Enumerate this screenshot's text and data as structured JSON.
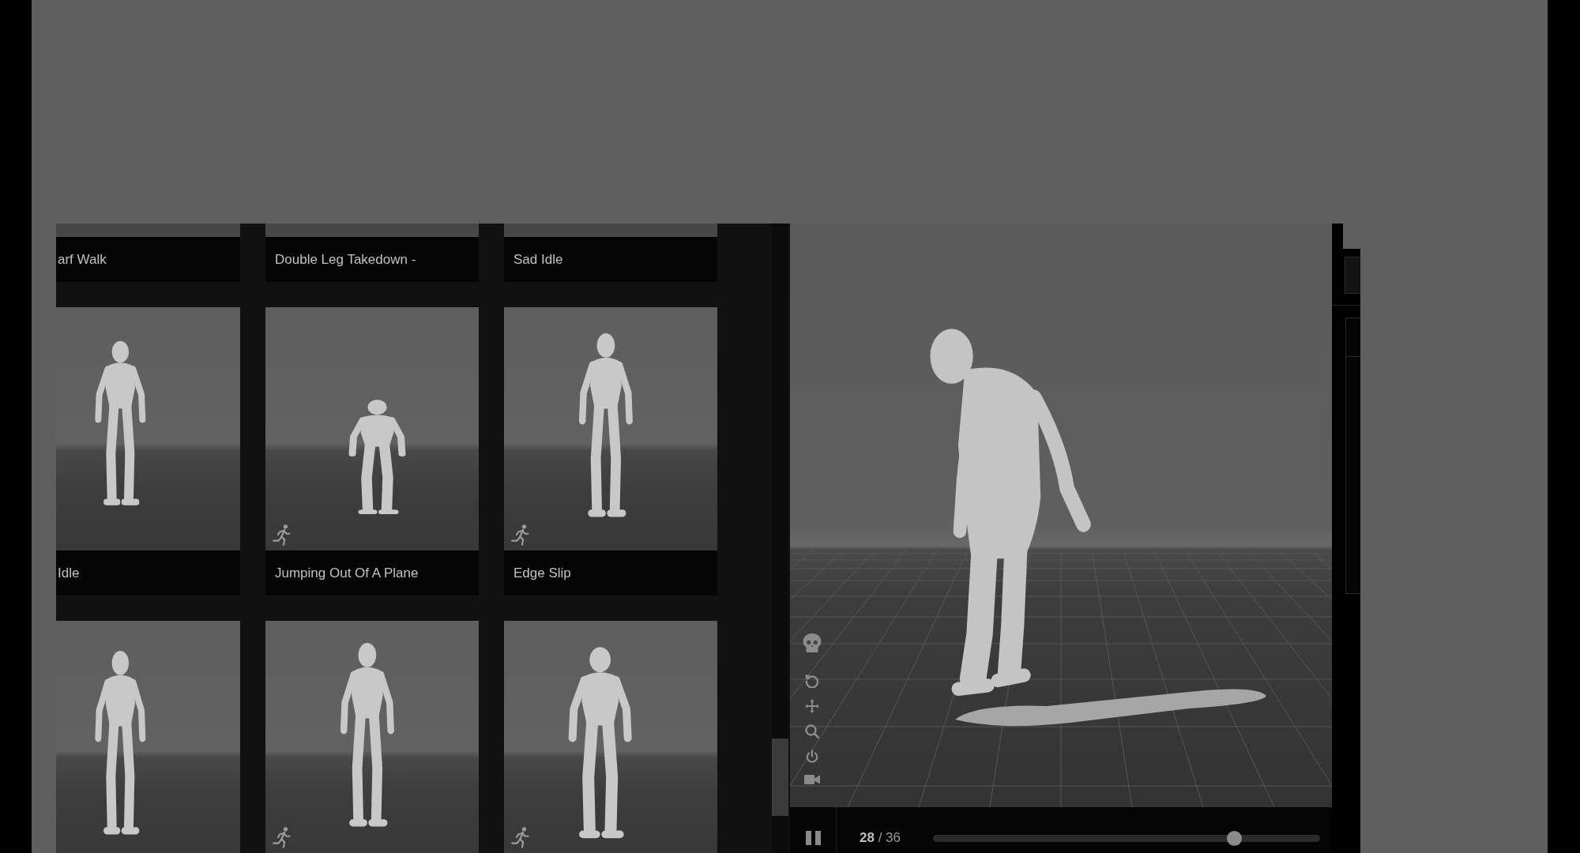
{
  "library": {
    "cards": [
      {
        "title": "arf Walk",
        "motion_badge": false
      },
      {
        "title": "Double Leg Takedown -",
        "motion_badge": false
      },
      {
        "title": "Sad Idle",
        "motion_badge": false
      },
      {
        "title": "Idle",
        "motion_badge": false
      },
      {
        "title": "Jumping Out Of A Plane",
        "motion_badge": true
      },
      {
        "title": "Edge Slip",
        "motion_badge": true
      },
      {
        "motion_badge": false
      },
      {
        "motion_badge": true
      },
      {
        "motion_badge": true
      }
    ]
  },
  "player": {
    "playing": true,
    "frame": "**28** / 36",
    "level": 0.79
  }
}
